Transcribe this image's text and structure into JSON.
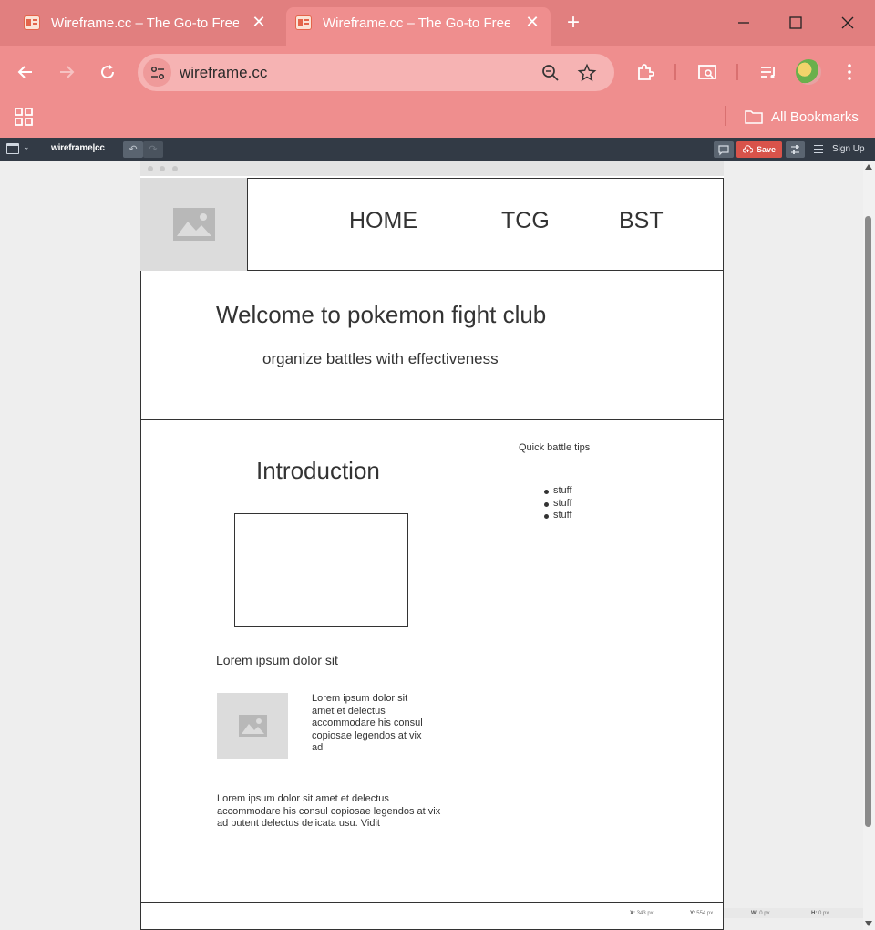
{
  "browser": {
    "tabs": [
      {
        "title": "Wireframe.cc – The Go-to Free,",
        "active": false
      },
      {
        "title": "Wireframe.cc – The Go-to Free,",
        "active": true
      }
    ],
    "new_tab_label": "+",
    "address": "wireframe.cc",
    "bookmarks": {
      "all_label": "All Bookmarks"
    },
    "accent_color": "#ef8e8e"
  },
  "app": {
    "brand": "wireframe|cc",
    "save_label": "Save",
    "signup_label": "Sign Up"
  },
  "wireframe": {
    "nav": [
      "HOME",
      "TCG",
      "BST"
    ],
    "hero_title": "Welcome to pokemon fight club",
    "hero_subtitle": "organize battles with effectiveness",
    "intro_title": "Introduction",
    "lorem_heading": "Lorem ipsum dolor sit",
    "lorem_side": "Lorem ipsum dolor sit amet et delectus accommodare his consul copiosae legendos at vix ad",
    "lorem_paragraph": "Lorem ipsum dolor sit amet et delectus accommodare his consul copiosae legendos at vix ad putent delectus delicata usu. Vidit",
    "tips_title": "Quick battle tips",
    "tips": [
      "stuff",
      "stuff",
      "stuff"
    ]
  },
  "status": {
    "x": "343 px",
    "y": "554 px",
    "w": "0 px",
    "h": "0 px"
  }
}
